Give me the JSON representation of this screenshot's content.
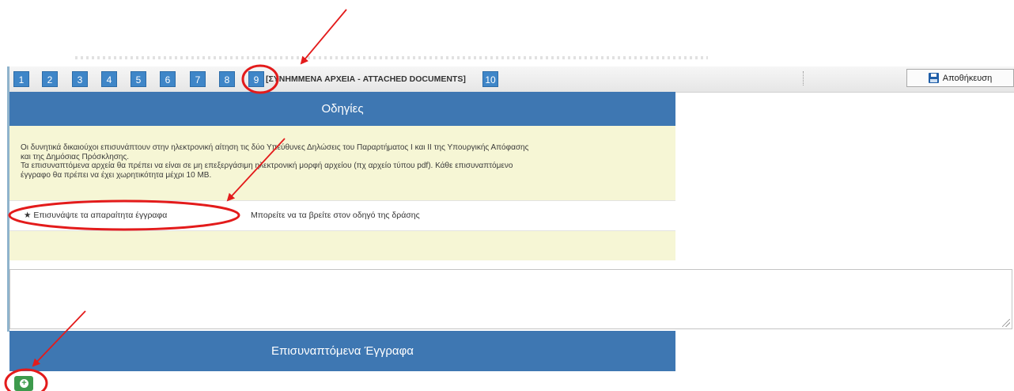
{
  "toolbar": {
    "steps": [
      "1",
      "2",
      "3",
      "4",
      "5",
      "6",
      "7",
      "8",
      "9",
      "10"
    ],
    "current_step_label": "[ΣΥΝΗΜΜΕΝΑ ΑΡΧΕΙΑ - ATTACHED DOCUMENTS]",
    "save_label": "Αποθήκευση"
  },
  "instructions": {
    "title": "Οδηγίες",
    "lines": [
      "Οι δυνητικά δικαιούχοι επισυνάπτουν στην ηλεκτρονική αίτηση τις δύο Υπεύθυνες Δηλώσεις του Παραρτήματος Ι και ΙΙ της Υπουργικής Απόφασης",
      "και της Δημόσιας Πρόσκλησης.",
      "Τα επισυναπτόμενα αρχεία θα πρέπει να είναι σε μη επεξεργάσιμη ηλεκτρονική μορφή αρχείου (πχ αρχείο τύπου pdf). Κάθε επισυναπτόμενο",
      "έγγραφο θα πρέπει να έχει χωρητικότητα μέχρι 10 MB."
    ],
    "required_label": "★ Επισυνάψτε τα απαραίτητα έγγραφα",
    "required_note": "Μπορείτε να τα βρείτε στον οδηγό της δράσης"
  },
  "attachments": {
    "title": "Επισυναπτόμενα Έγγραφα"
  },
  "colors": {
    "primary_blue": "#3e77b2",
    "instruction_bg": "#f6f6d5",
    "add_green": "#3d9a4c",
    "annotation_red": "#e31b1b"
  }
}
